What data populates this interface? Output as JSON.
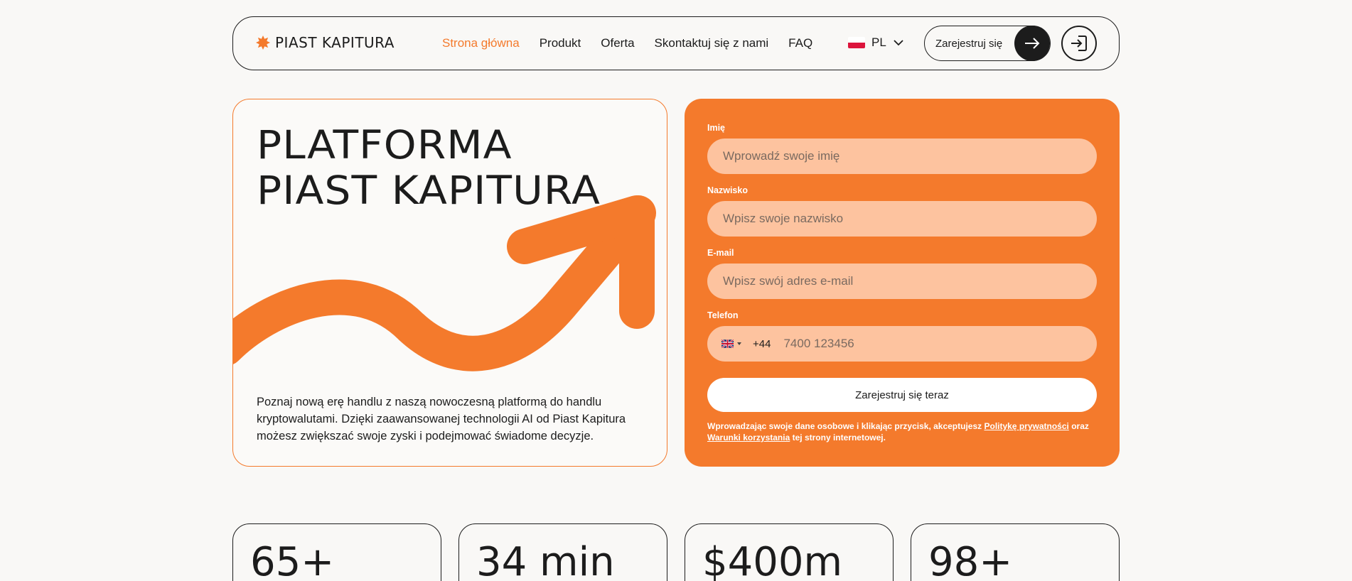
{
  "brand": {
    "name": "PIAST KAPITURA",
    "accent": "#f47a2c"
  },
  "nav": {
    "items": [
      {
        "label": "Strona główna",
        "active": true
      },
      {
        "label": "Produkt",
        "active": false
      },
      {
        "label": "Oferta",
        "active": false
      },
      {
        "label": "Skontaktuj się z nami",
        "active": false
      },
      {
        "label": "FAQ",
        "active": false
      }
    ]
  },
  "language": {
    "code": "PL",
    "flag": "poland-flag-icon"
  },
  "header": {
    "register_label": "Zarejestruj się",
    "register_icon": "arrow-right-icon",
    "login_icon": "login-icon"
  },
  "hero": {
    "title_line1": "PLATFORMA",
    "title_line2": "PIAST KAPITURA",
    "description": "Poznaj nową erę handlu z naszą nowoczesną platformą do handlu kryptowalutami. Dzięki zaawansowanej technologii AI od Piast Kapitura możesz zwiększać swoje zyski i podejmować świadome decyzje."
  },
  "form": {
    "first_name": {
      "label": "Imię",
      "placeholder": "Wprowadź swoje imię"
    },
    "last_name": {
      "label": "Nazwisko",
      "placeholder": "Wpisz swoje nazwisko"
    },
    "email": {
      "label": "E-mail",
      "placeholder": "Wpisz swój adres e-mail"
    },
    "phone": {
      "label": "Telefon",
      "dial_code": "+44",
      "placeholder": "7400 123456",
      "country_flag": "uk-flag-icon"
    },
    "submit_label": "Zarejestruj się teraz",
    "disclaimer_prefix": "Wprowadzając swoje dane osobowe i klikając przycisk, akceptujesz ",
    "privacy_link": "Politykę prywatności",
    "disclaimer_mid": " oraz ",
    "terms_link": "Warunki korzystania",
    "disclaimer_suffix": " tej strony internetowej."
  },
  "stats": [
    {
      "value": "65+"
    },
    {
      "value": "34 min"
    },
    {
      "value": "$400m"
    },
    {
      "value": "98+"
    }
  ]
}
